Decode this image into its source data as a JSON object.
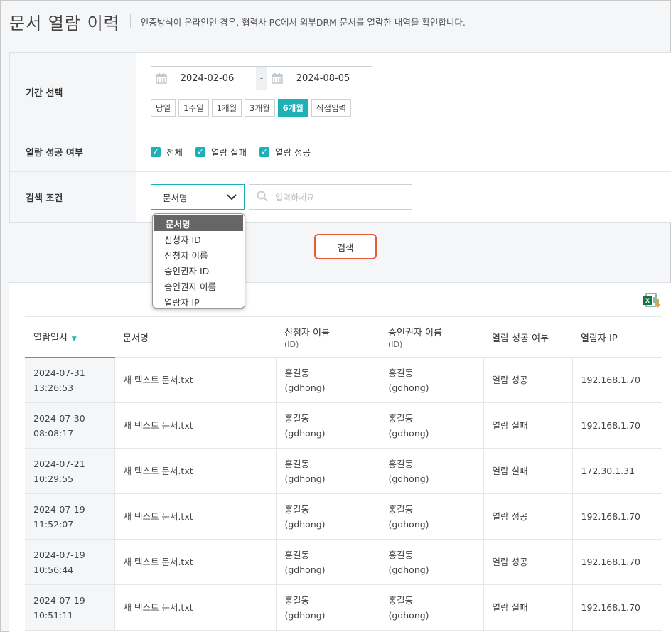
{
  "header": {
    "title": "문서 열람 이력",
    "description": "인증방식이 온라인인 경우, 협력사 PC에서 외부DRM 문서를 열람한 내역을 확인합니다."
  },
  "filters": {
    "period": {
      "label": "기간 선택",
      "start_date": "2024-02-06",
      "end_date": "2024-08-05",
      "separator": "-",
      "quick_buttons": [
        "당일",
        "1주일",
        "1개월",
        "3개월",
        "6개월",
        "직접입력"
      ],
      "active_quick": "6개월"
    },
    "success": {
      "label": "열람 성공 여부",
      "options": [
        {
          "label": "전체",
          "checked": true
        },
        {
          "label": "열람 실패",
          "checked": true
        },
        {
          "label": "열람 성공",
          "checked": true
        }
      ]
    },
    "search": {
      "label": "검색 조건",
      "selected": "문서명",
      "placeholder": "입력하세요",
      "dropdown_options": [
        "문서명",
        "신청자 ID",
        "신청자 이름",
        "승인권자 ID",
        "승인권자 이름",
        "열람자 IP"
      ]
    },
    "search_button": "검색"
  },
  "table": {
    "columns": [
      {
        "label": "열람일시",
        "sub": ""
      },
      {
        "label": "문서명",
        "sub": ""
      },
      {
        "label": "신청자 이름",
        "sub": "(ID)"
      },
      {
        "label": "승인권자 이름",
        "sub": "(ID)"
      },
      {
        "label": "열람 성공 여부",
        "sub": ""
      },
      {
        "label": "열람자 IP",
        "sub": ""
      }
    ],
    "rows": [
      {
        "date": "2024-07-31",
        "time": "13:26:53",
        "doc": "새 텍스트 문서.txt",
        "req_name": "홍길동",
        "req_id": "(gdhong)",
        "appr_name": "홍길동",
        "appr_id": "(gdhong)",
        "status": "열람 성공",
        "ip": "192.168.1.70"
      },
      {
        "date": "2024-07-30",
        "time": "08:08:17",
        "doc": "새 텍스트 문서.txt",
        "req_name": "홍길동",
        "req_id": "(gdhong)",
        "appr_name": "홍길동",
        "appr_id": "(gdhong)",
        "status": "열람 실패",
        "ip": "192.168.1.70"
      },
      {
        "date": "2024-07-21",
        "time": "10:29:55",
        "doc": "새 텍스트 문서.txt",
        "req_name": "홍길동",
        "req_id": "(gdhong)",
        "appr_name": "홍길동",
        "appr_id": "(gdhong)",
        "status": "열람 실패",
        "ip": "172.30.1.31"
      },
      {
        "date": "2024-07-19",
        "time": "11:52:07",
        "doc": "새 텍스트 문서.txt",
        "req_name": "홍길동",
        "req_id": "(gdhong)",
        "appr_name": "홍길동",
        "appr_id": "(gdhong)",
        "status": "열람 성공",
        "ip": "192.168.1.70"
      },
      {
        "date": "2024-07-19",
        "time": "10:56:44",
        "doc": "새 텍스트 문서.txt",
        "req_name": "홍길동",
        "req_id": "(gdhong)",
        "appr_name": "홍길동",
        "appr_id": "(gdhong)",
        "status": "열람 성공",
        "ip": "192.168.1.70"
      },
      {
        "date": "2024-07-19",
        "time": "10:51:11",
        "doc": "새 텍스트 문서.txt",
        "req_name": "홍길동",
        "req_id": "(gdhong)",
        "appr_name": "홍길동",
        "appr_id": "(gdhong)",
        "status": "열람 실패",
        "ip": "192.168.1.70"
      }
    ]
  },
  "colors": {
    "accent": "#1fb0b6",
    "highlight_border": "#e8583a",
    "excel_green": "#1d7044",
    "excel_arrow": "#f0a030"
  },
  "icons": [
    "calendar-icon",
    "chevron-down-icon",
    "search-icon",
    "checkbox-checked-icon",
    "excel-download-icon",
    "sort-desc-icon"
  ]
}
